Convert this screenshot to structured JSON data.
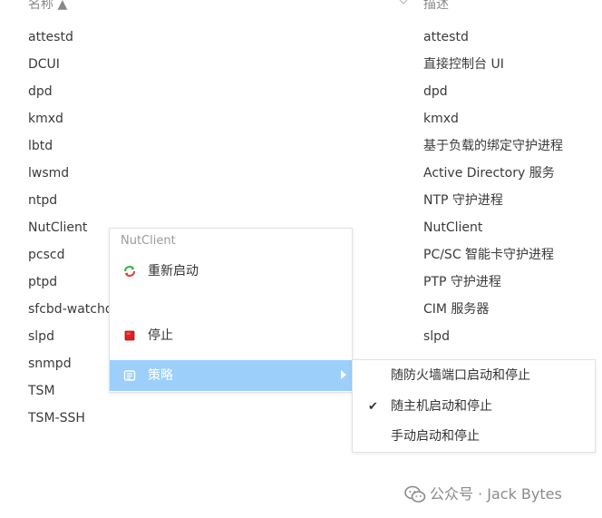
{
  "header": {
    "name_label": "名称 ▲",
    "desc_label": "描述"
  },
  "services": [
    {
      "name": "attestd",
      "desc": "attestd"
    },
    {
      "name": "DCUI",
      "desc": "直接控制台 UI"
    },
    {
      "name": "dpd",
      "desc": "dpd"
    },
    {
      "name": "kmxd",
      "desc": "kmxd"
    },
    {
      "name": "lbtd",
      "desc": "基于负载的绑定守护进程"
    },
    {
      "name": "lwsmd",
      "desc": "Active Directory 服务"
    },
    {
      "name": "ntpd",
      "desc": "NTP 守护进程"
    },
    {
      "name": "NutClient",
      "desc": "NutClient"
    },
    {
      "name": "pcscd",
      "desc": "PC/SC 智能卡守护进程"
    },
    {
      "name": "ptpd",
      "desc": "PTP 守护进程"
    },
    {
      "name": "sfcbd-watchd",
      "desc": "CIM 服务器"
    },
    {
      "name": "slpd",
      "desc": "slpd"
    },
    {
      "name": "snmpd",
      "desc": ""
    },
    {
      "name": "TSM",
      "desc": ""
    },
    {
      "name": "TSM-SSH",
      "desc": ""
    }
  ],
  "context_menu": {
    "title": "NutClient",
    "restart_label": "重新启动",
    "stop_label": "停止",
    "policy_label": "策略",
    "icons": {
      "restart": "restart-icon",
      "stop": "stop-icon",
      "policy": "policy-icon",
      "submenu": "chevron-right-icon"
    }
  },
  "policy_menu": {
    "items": [
      {
        "label": "随防火墙端口启动和停止",
        "checked": false
      },
      {
        "label": "随主机启动和停止",
        "checked": true
      },
      {
        "label": "手动启动和停止",
        "checked": false
      }
    ],
    "check_glyph": "✔"
  },
  "watermark": {
    "text": "公众号 · Jack Bytes",
    "icon": "wechat-icon"
  },
  "colors": {
    "highlight": "#9ccffa",
    "stop_red": "#e02020",
    "restart_green": "#3bb54a",
    "restart_red": "#e0463c"
  }
}
